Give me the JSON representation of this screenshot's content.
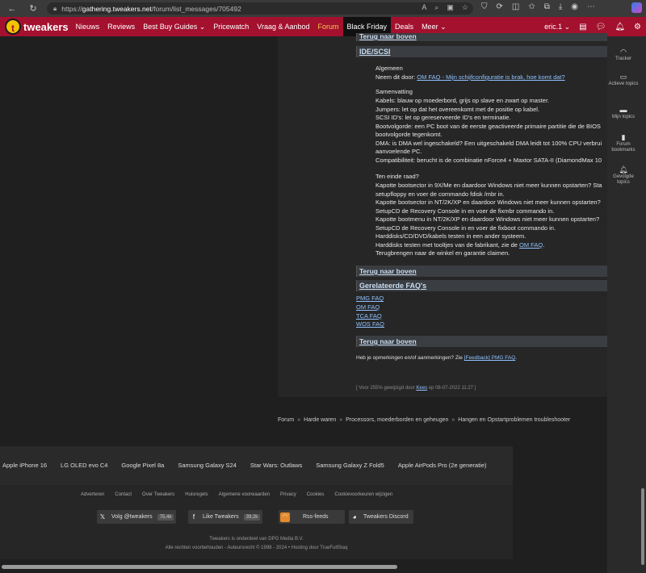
{
  "browser": {
    "url_prefix": "https://",
    "url_host": "gathering.tweakers.net",
    "url_path": "/forum/list_messages/705492"
  },
  "topnav": {
    "logo": "tweakers",
    "items": [
      "Nieuws",
      "Reviews",
      "Best Buy Guides ⌄",
      "Pricewatch",
      "Vraag & Aanbod",
      "Forum",
      "Black Friday",
      "Deals",
      "Meer ⌄"
    ],
    "user": "eric.1 ⌄"
  },
  "sidebar": {
    "tracker": "Tracker",
    "active_topics": "Actieve topics",
    "my_topics": "Mijn topics",
    "forum_bookmarks": "Forum bookmarks",
    "followed_topics": "Gevolgde topics"
  },
  "content": {
    "top_back": "Terug naar boven",
    "ide_title": "IDE/SCSI",
    "general_title": "Algemeen",
    "read_first_prefix": "Neem dit door: ",
    "read_first_link": "OM FAQ - Mijn schijfconfiguratie is brak, hoe komt dat?",
    "summary_title": "Samenvatting",
    "summary_items": [
      "Kabels: blauw op moederbord, grijs op slave en zwart op master.",
      "Jumpers: let op dat het overeenkomt met de positie op kabel.",
      "SCSI ID's: let op gereserveerde ID's en terminatie.",
      "Bootvolgorde: een PC boot van de eerste geactiveerde primaire partitie die de BIOS",
      "bootvolgorde tegenkomt.",
      "DMA: is DMA wel ingeschakeld? Een uitgeschakeld DMA leidt tot 100% CPU verbrui",
      "aanvoelende PC.",
      "Compatibiliteit: berucht is de combinatie nForce4 + Maxtor SATA-II (DiamondMax 10"
    ],
    "help_title": "Ten einde raad?",
    "help_items": [
      "Kapotte bootsector in 9X/Me en daardoor Windows niet meer kunnen opstarten? Sta",
      "setupfloppy en voer de commando fdisk /mbr in.",
      "Kapotte bootsector in NT/2K/XP en daardoor Windows niet meer kunnen opstarten?",
      "SetupCD de Recovery Console in en voer de fixmbr commando in.",
      "Kapotte bootmenu in NT/2K/XP en daardoor Windows niet meer kunnen opstarten?",
      "SetupCD de Recovery Console in en voer de fixboot commando in.",
      "Harddisks/CD/DVD/kabels testen in een ander systeem.",
      "Harddisks testen met tooltjes van de fabrikant, zie de ",
      "Terugbrengen naar de winkel en garantie claimen."
    ],
    "om_faq_link": "OM FAQ",
    "back_top_1": "Terug naar boven",
    "related_title": "Gerelateerde FAQ's",
    "related_links": [
      "PMG FAQ",
      "OM FAQ",
      "TCA FAQ",
      "WOS FAQ"
    ],
    "back_top_2": "Terug naar boven",
    "remarks_prefix": "Heb je opmerkingen en/of aanmerkingen? Zie ",
    "remarks_link": "[Feedback] PMG FAQ",
    "edit_prefix": "[ Voor 255% gewijzigd door ",
    "edit_user": "Kees",
    "edit_suffix": " op 08-07-2022 11:27 ]"
  },
  "breadcrumb": [
    "Forum",
    "Harde waren",
    "Processors, moederborden en geheugen",
    "Hangen en Opstartproblemen troubleshooter"
  ],
  "footer": {
    "popular": [
      "Apple iPhone 16",
      "LG OLED evo C4",
      "Google Pixel 8a",
      "Samsung Galaxy S24",
      "Star Wars: Outlaws",
      "Samsung Galaxy Z Fold5",
      "Apple AirPods Pro (2e generatie)"
    ],
    "links": [
      "Adverteren",
      "Contact",
      "Over Tweakers",
      "Huisregels",
      "Algemene voorwaarden",
      "Privacy",
      "Cookies",
      "Cookievoorkeuren wijzigen"
    ],
    "social": {
      "twitter_label": "Volg @tweakers",
      "twitter_count": "75,4k",
      "facebook_label": "Like Tweakers",
      "facebook_count": "39,2k",
      "rss_label": "Rss-feeds",
      "discord_label": "Tweakers Discord"
    },
    "copyright_1": "Tweakers is onderdeel van DPG Media B.V.",
    "copyright_2": "Alle rechten voorbehouden - Auteursrecht © 1998 - 2024  •  Hosting door TrueFullStaq"
  }
}
